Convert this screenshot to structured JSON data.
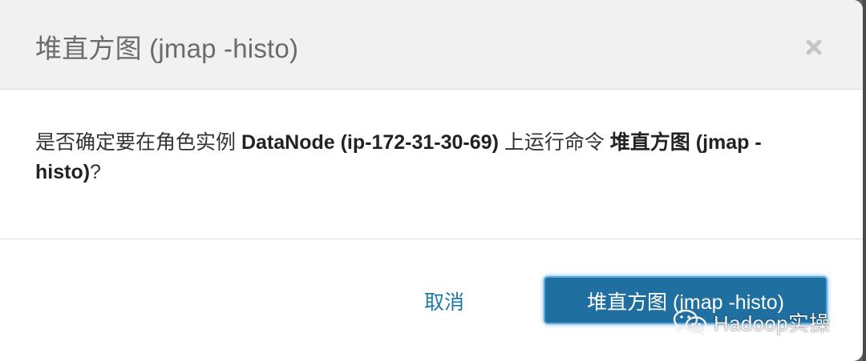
{
  "dialog": {
    "title": "堆直方图 (jmap -histo)",
    "close_label": "×",
    "message": {
      "prefix": "是否确定要在角色实例 ",
      "role_instance": "DataNode (ip-172-31-30-69)",
      "middle": " 上运行命令 ",
      "command": "堆直方图 (jmap -histo)",
      "suffix": "?"
    },
    "cancel_label": "取消",
    "confirm_label": "堆直方图 (jmap -histo)"
  },
  "watermark": {
    "text": "Hadoop实操"
  },
  "colors": {
    "header_bg": "#f1f1f1",
    "primary": "#1f6fa0",
    "link": "#1f78a8"
  }
}
